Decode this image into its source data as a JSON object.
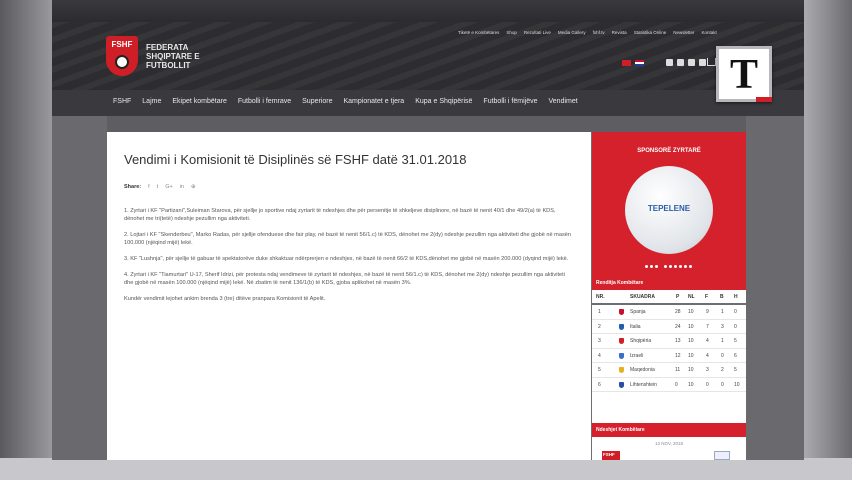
{
  "logo": {
    "badge": "FSHF",
    "line1": "FEDERATA",
    "line2": "SHQIPTARE E",
    "line3": "FUTBOLLIT"
  },
  "channel_logo": "T",
  "top_links": [
    "Tiketë e Kombëtares",
    "Shop",
    "Rezultati Live",
    "Media Gallery",
    "fshf.tv",
    "Revista",
    "Statistika Online",
    "Newsletter",
    "Kontakt"
  ],
  "nav": [
    "FSHF",
    "Lajme",
    "Ekipet kombëtare",
    "Futbolli i femrave",
    "Superiore",
    "Kampionatet e tjera",
    "Kupa e Shqipërisë",
    "Futbolli i fëmijëve",
    "Vendimet"
  ],
  "article": {
    "title": "Vendimi i Komisionit të Disiplinës së FSHF datë 31.01.2018",
    "share_label": "Share:",
    "share_icons": [
      "f",
      "t",
      "G+",
      "in",
      "⊕"
    ],
    "paragraphs": [
      "1. Zyrtari i KF \"Partizani\",Suleiman Starova, për sjellje jo sportive ndaj zyrtarit të ndeshjes dhe për persenitje të shkeljeve disiplinore, në bazë të nenit 40/1 dhe 49/2(a) të KDS, dënohet me tri(tetë) ndeshje pezullim nga aktiviteti.",
      "2. Lojtari i KF \"Skenderbeu\", Marko Radas, për sjellje ofenduese dhe fair play, në bazë të nenit 56/1.c) të KDS, dënohet me 2(dy) ndeshje pezullim nga aktiviteti dhe gjobë në masën 100.000 (njëqind mijë) lekë.",
      "3. KF \"Lushnja\", për sjellje të gabuar të spektatorëve duke shkaktuar ndërprerjen e ndeshjes, në bazë të nenit 66/2 të KDS,dënohet me gjobë në masën 200.000 (dyqind mijë) lekë.",
      "4. Zyrtari i KF \"Tiamurtari\" U-17, Sherif Idrizi, për protesta ndaj vendimeve të zyrtarit të ndeshjes, në bazë të nenit 56/1.c) të KDS, dënohet me 2(dy) ndeshje pezullim nga aktiviteti dhe gjobë në masën 100.000 (njëqind mijë) lekë. Në zbatim të nenit 136/1(b) të KDS, gjoba aplikohet në masën 3%.",
      "Kundër vendimit lejohet ankim brenda 3 (tre) ditëve pranpara Komisionit të Apelit."
    ]
  },
  "sponsor": {
    "title": "SPONSORË ZYRTARË",
    "brand": "TEPELENE"
  },
  "ranking": {
    "title": "Renditja Kombëtare",
    "columns": [
      "NR.",
      "SKUADRA",
      "P",
      "NL",
      "F",
      "B",
      "H"
    ],
    "rows": [
      {
        "nr": "1",
        "team": "Spanja",
        "p": "28",
        "nl": "10",
        "f": "9",
        "b": "1",
        "h": "0",
        "color": "#c8102e"
      },
      {
        "nr": "2",
        "team": "Italia",
        "p": "24",
        "nl": "10",
        "f": "7",
        "b": "3",
        "h": "0",
        "color": "#1e5fb4"
      },
      {
        "nr": "3",
        "team": "Shqipëria",
        "p": "13",
        "nl": "10",
        "f": "4",
        "b": "1",
        "h": "5",
        "color": "#d01e26"
      },
      {
        "nr": "4",
        "team": "Izraeli",
        "p": "12",
        "nl": "10",
        "f": "4",
        "b": "0",
        "h": "6",
        "color": "#3a6ec8"
      },
      {
        "nr": "5",
        "team": "Maqedonia",
        "p": "11",
        "nl": "10",
        "f": "3",
        "b": "2",
        "h": "5",
        "color": "#e6b020"
      },
      {
        "nr": "6",
        "team": "Lihtenshtein",
        "p": "0",
        "nl": "10",
        "f": "0",
        "b": "0",
        "h": "10",
        "color": "#2a4ea0"
      }
    ]
  },
  "next_matches": {
    "title": "Ndeshjet Kombëtare",
    "date": "13 NOV, 2018",
    "home_badge": "FSHF"
  }
}
